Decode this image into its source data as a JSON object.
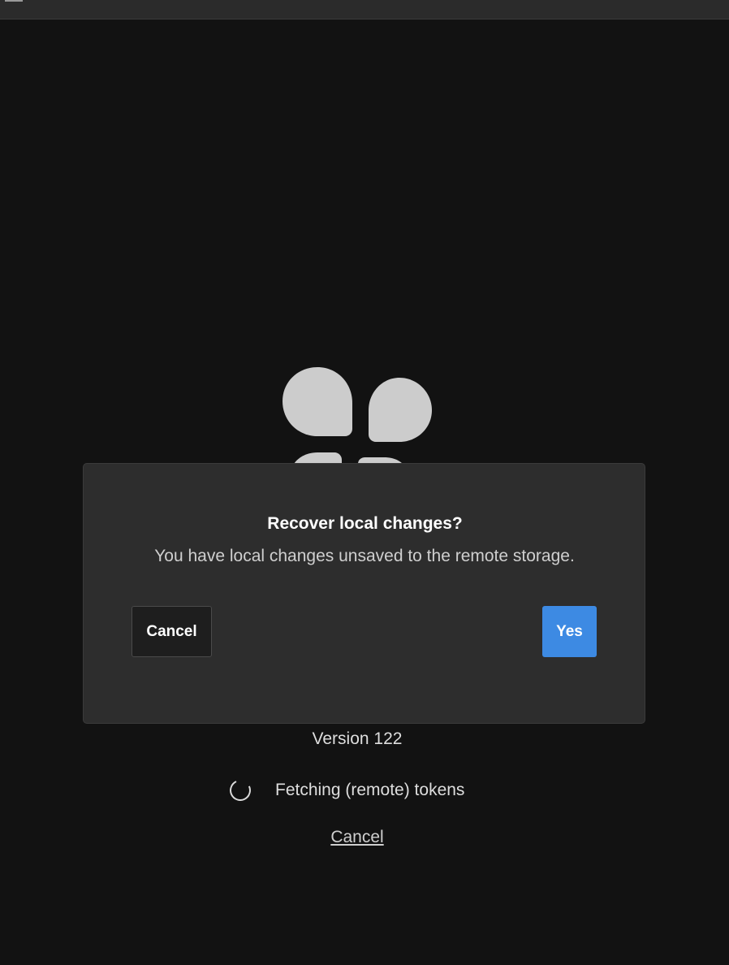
{
  "loading": {
    "version": "Version 122",
    "status": "Fetching (remote) tokens",
    "cancel_link": "Cancel",
    "logo_icon": "tokens-studio-logo-icon",
    "spinner_icon": "spinner-icon"
  },
  "dialog": {
    "title": "Recover local changes?",
    "message": "You have local changes unsaved to the remote storage.",
    "cancel_label": "Cancel",
    "confirm_label": "Yes"
  },
  "colors": {
    "background": "#121212",
    "dialog_background": "#2d2d2d",
    "primary_button": "#3d8ae3",
    "logo": "#cccccc"
  }
}
